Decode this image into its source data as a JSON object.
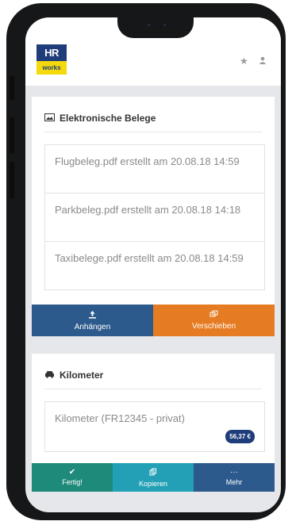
{
  "header": {
    "logo_top": "HR",
    "logo_bottom": "works",
    "star_icon": "star-icon",
    "user_icon": "user-icon"
  },
  "belege": {
    "title": "Elektronische Belege",
    "icon": "image-icon",
    "items": [
      {
        "label": "Flugbeleg.pdf erstellt am 20.08.18 14:59"
      },
      {
        "label": "Parkbeleg.pdf erstellt am 20.08.18 14:18"
      },
      {
        "label": "Taxibelege.pdf erstellt am 20.08.18 14:59"
      }
    ],
    "actions": {
      "attach_label": "Anhängen",
      "attach_icon": "upload-icon",
      "attach_color": "#2c5a8c",
      "move_label": "Verschieben",
      "move_icon": "move-icon",
      "move_color": "#e57b22"
    }
  },
  "kilometer": {
    "title": "Kilometer",
    "icon": "car-icon",
    "item_label": "Kilometer (FR12345 - privat)",
    "amount_badge": "56,37 €"
  },
  "bottombar": {
    "done_label": "Fertig!",
    "done_color": "#1e8a7a",
    "copy_label": "Kopieren",
    "copy_color": "#23a0b5",
    "more_label": "Mehr",
    "more_color": "#2c5a8c"
  }
}
